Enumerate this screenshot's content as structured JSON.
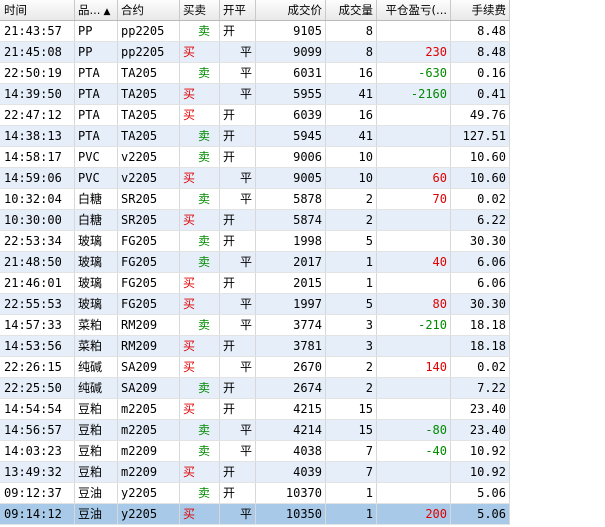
{
  "headers": {
    "time": "时间",
    "product": "品...",
    "sort_icon": "▲",
    "contract": "合约",
    "side": "买卖",
    "openclose": "开平",
    "price": "成交价",
    "volume": "成交量",
    "pnl": "平仓盈亏(...",
    "fee": "手续费"
  },
  "colors": {
    "buy": "#e00000",
    "sell": "#008a00",
    "selected_row": "#a8cae8",
    "alt_row": "#e6eef9"
  },
  "rows": [
    {
      "time": "21:43:57",
      "product": "PP",
      "contract": "pp2205",
      "side": "卖",
      "oc": "开",
      "price": "9105",
      "vol": "8",
      "pnl": "",
      "fee": "8.48"
    },
    {
      "time": "21:45:08",
      "product": "PP",
      "contract": "pp2205",
      "side": "买",
      "oc": "平",
      "price": "9099",
      "vol": "8",
      "pnl": "230",
      "fee": "8.48"
    },
    {
      "time": "22:50:19",
      "product": "PTA",
      "contract": "TA205",
      "side": "卖",
      "oc": "平",
      "price": "6031",
      "vol": "16",
      "pnl": "-630",
      "fee": "0.16"
    },
    {
      "time": "14:39:50",
      "product": "PTA",
      "contract": "TA205",
      "side": "买",
      "oc": "平",
      "price": "5955",
      "vol": "41",
      "pnl": "-2160",
      "fee": "0.41"
    },
    {
      "time": "22:47:12",
      "product": "PTA",
      "contract": "TA205",
      "side": "买",
      "oc": "开",
      "price": "6039",
      "vol": "16",
      "pnl": "",
      "fee": "49.76"
    },
    {
      "time": "14:38:13",
      "product": "PTA",
      "contract": "TA205",
      "side": "卖",
      "oc": "开",
      "price": "5945",
      "vol": "41",
      "pnl": "",
      "fee": "127.51"
    },
    {
      "time": "14:58:17",
      "product": "PVC",
      "contract": "v2205",
      "side": "卖",
      "oc": "开",
      "price": "9006",
      "vol": "10",
      "pnl": "",
      "fee": "10.60"
    },
    {
      "time": "14:59:06",
      "product": "PVC",
      "contract": "v2205",
      "side": "买",
      "oc": "平",
      "price": "9005",
      "vol": "10",
      "pnl": "60",
      "fee": "10.60"
    },
    {
      "time": "10:32:04",
      "product": "白糖",
      "contract": "SR205",
      "side": "卖",
      "oc": "平",
      "price": "5878",
      "vol": "2",
      "pnl": "70",
      "fee": "0.02"
    },
    {
      "time": "10:30:00",
      "product": "白糖",
      "contract": "SR205",
      "side": "买",
      "oc": "开",
      "price": "5874",
      "vol": "2",
      "pnl": "",
      "fee": "6.22"
    },
    {
      "time": "22:53:34",
      "product": "玻璃",
      "contract": "FG205",
      "side": "卖",
      "oc": "开",
      "price": "1998",
      "vol": "5",
      "pnl": "",
      "fee": "30.30"
    },
    {
      "time": "21:48:50",
      "product": "玻璃",
      "contract": "FG205",
      "side": "卖",
      "oc": "平",
      "price": "2017",
      "vol": "1",
      "pnl": "40",
      "fee": "6.06"
    },
    {
      "time": "21:46:01",
      "product": "玻璃",
      "contract": "FG205",
      "side": "买",
      "oc": "开",
      "price": "2015",
      "vol": "1",
      "pnl": "",
      "fee": "6.06"
    },
    {
      "time": "22:55:53",
      "product": "玻璃",
      "contract": "FG205",
      "side": "买",
      "oc": "平",
      "price": "1997",
      "vol": "5",
      "pnl": "80",
      "fee": "30.30"
    },
    {
      "time": "14:57:33",
      "product": "菜粕",
      "contract": "RM209",
      "side": "卖",
      "oc": "平",
      "price": "3774",
      "vol": "3",
      "pnl": "-210",
      "fee": "18.18"
    },
    {
      "time": "14:53:56",
      "product": "菜粕",
      "contract": "RM209",
      "side": "买",
      "oc": "开",
      "price": "3781",
      "vol": "3",
      "pnl": "",
      "fee": "18.18"
    },
    {
      "time": "22:26:15",
      "product": "纯碱",
      "contract": "SA209",
      "side": "买",
      "oc": "平",
      "price": "2670",
      "vol": "2",
      "pnl": "140",
      "fee": "0.02"
    },
    {
      "time": "22:25:50",
      "product": "纯碱",
      "contract": "SA209",
      "side": "卖",
      "oc": "开",
      "price": "2674",
      "vol": "2",
      "pnl": "",
      "fee": "7.22"
    },
    {
      "time": "14:54:54",
      "product": "豆粕",
      "contract": "m2205",
      "side": "买",
      "oc": "开",
      "price": "4215",
      "vol": "15",
      "pnl": "",
      "fee": "23.40"
    },
    {
      "time": "14:56:57",
      "product": "豆粕",
      "contract": "m2205",
      "side": "卖",
      "oc": "平",
      "price": "4214",
      "vol": "15",
      "pnl": "-80",
      "fee": "23.40"
    },
    {
      "time": "14:03:23",
      "product": "豆粕",
      "contract": "m2209",
      "side": "卖",
      "oc": "平",
      "price": "4038",
      "vol": "7",
      "pnl": "-40",
      "fee": "10.92"
    },
    {
      "time": "13:49:32",
      "product": "豆粕",
      "contract": "m2209",
      "side": "买",
      "oc": "开",
      "price": "4039",
      "vol": "7",
      "pnl": "",
      "fee": "10.92"
    },
    {
      "time": "09:12:37",
      "product": "豆油",
      "contract": "y2205",
      "side": "卖",
      "oc": "开",
      "price": "10370",
      "vol": "1",
      "pnl": "",
      "fee": "5.06"
    },
    {
      "time": "09:14:12",
      "product": "豆油",
      "contract": "y2205",
      "side": "买",
      "oc": "平",
      "price": "10350",
      "vol": "1",
      "pnl": "200",
      "fee": "5.06"
    }
  ]
}
